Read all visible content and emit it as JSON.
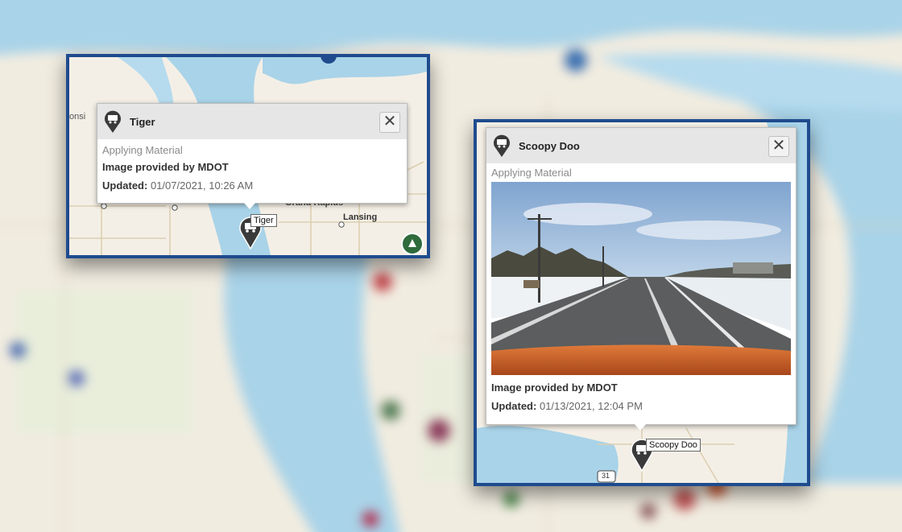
{
  "inset_left": {
    "popup": {
      "title": "Tiger",
      "activity": "Applying Material",
      "provider": "Image provided by MDOT",
      "updated_label": "Updated:",
      "updated_value": "01/07/2021, 10:26 AM",
      "close_glyph": "✕",
      "icon": "truck-marker-icon"
    },
    "pin_label": "Tiger",
    "map_labels": {
      "left_fragment": "onsi",
      "city_1": "Grand Rapids",
      "city_2": "Lansing"
    }
  },
  "inset_right": {
    "popup": {
      "title": "Scoopy Doo",
      "activity": "Applying Material",
      "provider": "Image provided by MDOT",
      "updated_label": "Updated:",
      "updated_value": "01/13/2021, 12:04 PM",
      "close_glyph": "✕",
      "icon": "truck-marker-icon",
      "photo": "dashcam-road-photo"
    },
    "pin_label": "Scoopy Doo",
    "map_labels": {
      "route_shield": "31"
    }
  },
  "colors": {
    "frame": "#1f4b8e",
    "water": "#a9d3e8",
    "land": "#f3eee4",
    "pin": "#3a3a3a",
    "popup_header": "#e6e6e6"
  }
}
